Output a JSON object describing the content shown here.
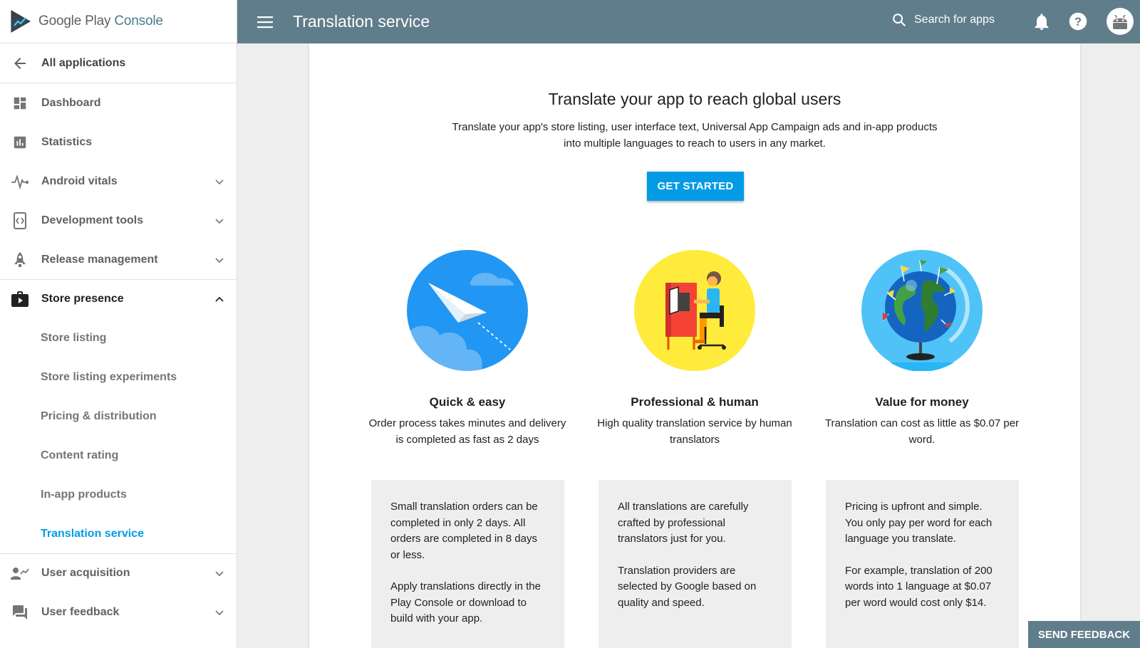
{
  "brand": {
    "name_part1": "Google Play",
    "name_part2": "Console"
  },
  "header": {
    "title": "Translation service",
    "search_label": "Search for apps"
  },
  "sidebar": {
    "back_label": "All applications",
    "items": [
      {
        "label": "Dashboard",
        "icon": "dashboard-icon"
      },
      {
        "label": "Statistics",
        "icon": "bar-chart-icon"
      },
      {
        "label": "Android vitals",
        "icon": "pulse-icon",
        "expandable": true
      },
      {
        "label": "Development tools",
        "icon": "code-icon",
        "expandable": true
      },
      {
        "label": "Release management",
        "icon": "rocket-icon",
        "expandable": true
      },
      {
        "label": "Store presence",
        "icon": "store-icon",
        "expanded": true
      },
      {
        "label": "User acquisition",
        "icon": "user-trend-icon",
        "expandable": true
      },
      {
        "label": "User feedback",
        "icon": "feedback-icon",
        "expandable": true
      }
    ],
    "store_presence_sub": [
      "Store listing",
      "Store listing experiments",
      "Pricing & distribution",
      "Content rating",
      "In-app products",
      "Translation service"
    ]
  },
  "hero": {
    "title": "Translate your app to reach global users",
    "subtitle": "Translate your app's store listing, user interface text, Universal App Campaign ads and in-app products into multiple languages to reach to users in any market.",
    "cta_label": "GET STARTED"
  },
  "features": [
    {
      "title": "Quick & easy",
      "desc": "Order process takes minutes and delivery is completed as fast as 2 days",
      "box_p1": "Small translation orders can be completed in only 2 days. All orders are completed in 8 days or less.",
      "box_p2": "Apply translations directly in the Play Console or download to build with your app."
    },
    {
      "title": "Professional & human",
      "desc": "High quality translation service by human translators",
      "box_p1": "All translations are carefully crafted by professional translators just for you.",
      "box_p2": "Translation providers are selected by Google based on quality and speed."
    },
    {
      "title": "Value for money",
      "desc": "Translation can cost as little as $0.07 per word.",
      "box_p1": "Pricing is upfront and simple. You only pay per word for each language you translate.",
      "box_p2": "For example, translation of 200 words into 1 language at $0.07 per word would cost only $14."
    }
  ],
  "feedback_label": "SEND FEEDBACK",
  "colors": {
    "header": "#607d8b",
    "accent": "#039be5",
    "sidebar_bg": "#ffffff",
    "content_bg": "#eeeeee"
  }
}
